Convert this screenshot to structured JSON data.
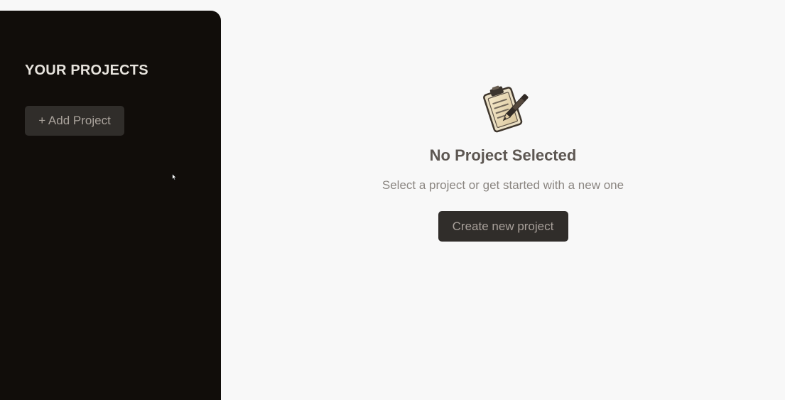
{
  "sidebar": {
    "title": "YOUR PROJECTS",
    "add_button_label": "+ Add Project"
  },
  "main": {
    "empty_state": {
      "icon": "clipboard-icon",
      "title": "No Project Selected",
      "subtitle": "Select a project or get started with a new one",
      "create_button_label": "Create new project"
    }
  },
  "colors": {
    "sidebar_background": "#110d0a",
    "main_background": "#f8f8f8",
    "button_background": "#302d2a",
    "button_text": "#aaa39c",
    "title_text": "#5d5752",
    "subtitle_text": "#8a8580"
  }
}
